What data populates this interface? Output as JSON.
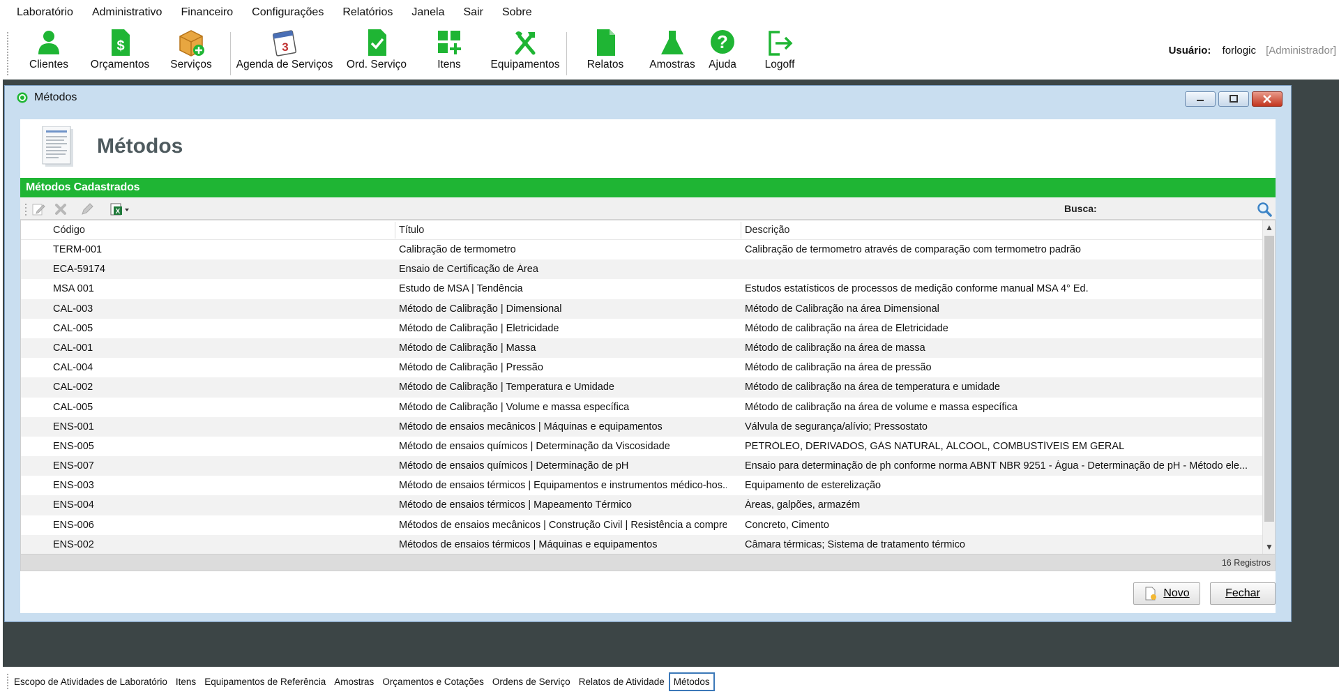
{
  "menu": [
    "Laboratório",
    "Administrativo",
    "Financeiro",
    "Configurações",
    "Relatórios",
    "Janela",
    "Sair",
    "Sobre"
  ],
  "toolbar": {
    "clientes": "Clientes",
    "orcamentos": "Orçamentos",
    "servicos": "Serviços",
    "agenda": "Agenda de Serviços",
    "ord_servico": "Ord. Serviço",
    "itens": "Itens",
    "equipamentos": "Equipamentos",
    "relatos": "Relatos",
    "amostras": "Amostras",
    "ajuda": "Ajuda",
    "logoff": "Logoff"
  },
  "user": {
    "label": "Usuário:",
    "name": "forlogic",
    "role": "[Administrador]"
  },
  "window": {
    "title": "Métodos",
    "heading": "Métodos"
  },
  "grid": {
    "section_title": "Métodos Cadastrados",
    "search_label": "Busca:",
    "search_value": "",
    "columns": [
      "Código",
      "Título",
      "Descrição"
    ],
    "rows": [
      [
        "TERM-001",
        "Calibração de termometro",
        "Calibração de termometro através de comparação com termometro padrão"
      ],
      [
        "ECA-59174",
        "Ensaio de Certificação de Área",
        ""
      ],
      [
        "MSA 001",
        "Estudo de MSA | Tendência",
        "Estudos estatísticos de processos de medição conforme manual MSA 4° Ed."
      ],
      [
        "CAL-003",
        "Método de Calibração | Dimensional",
        "Método de Calibração na área Dimensional"
      ],
      [
        "CAL-005",
        "Método de Calibração | Eletricidade",
        "Método de calibração na área de Eletricidade"
      ],
      [
        "CAL-001",
        "Método de Calibração | Massa",
        "Método de calibração na área de massa"
      ],
      [
        "CAL-004",
        "Método de Calibração | Pressão",
        "Método de calibração na área de pressão"
      ],
      [
        "CAL-002",
        "Método de Calibração | Temperatura e Umidade",
        "Método de calibração na área de temperatura e umidade"
      ],
      [
        "CAL-005",
        "Método de Calibração | Volume e massa específica",
        "Método de calibração na área de volume e massa específica"
      ],
      [
        "ENS-001",
        "Método de ensaios mecânicos | Máquinas e equipamentos",
        "Válvula de segurança/alívio; Pressostato"
      ],
      [
        "ENS-005",
        "Método de ensaios químicos | Determinação da Viscosidade",
        "PETRÓLEO, DERIVADOS, GÁS NATURAL, ÁLCOOL, COMBUSTÍVEIS EM GERAL"
      ],
      [
        "ENS-007",
        "Método de ensaios químicos | Determinação de pH",
        "Ensaio para determinação de ph conforme norma ABNT NBR 9251 - Água - Determinação de pH - Método ele..."
      ],
      [
        "ENS-003",
        "Método de ensaios térmicos | Equipamentos e instrumentos médico-hos...",
        "Equipamento de esterelização"
      ],
      [
        "ENS-004",
        "Método de ensaios térmicos | Mapeamento Térmico",
        "Áreas, galpões, armazém"
      ],
      [
        "ENS-006",
        "Métodos de ensaios mecânicos | Construção Civil | Resistência a compre...",
        "Concreto, Cimento"
      ],
      [
        "ENS-002",
        "Métodos de ensaios térmicos | Máquinas e equipamentos",
        "Câmara térmicas; Sistema de tratamento térmico"
      ]
    ],
    "record_count": "16 Registros"
  },
  "buttons": {
    "novo": "Novo",
    "fechar": "Fechar"
  },
  "tabs": [
    "Escopo de Atividades de Laboratório",
    "Itens",
    "Equipamentos de Referência",
    "Amostras",
    "Orçamentos e Cotações",
    "Ordens de Serviço",
    "Relatos de Atividade",
    "Métodos"
  ],
  "active_tab": 7,
  "colors": {
    "accent_green": "#1fb534",
    "mdi_background": "#3c4546",
    "window_frame": "#c9def0"
  }
}
